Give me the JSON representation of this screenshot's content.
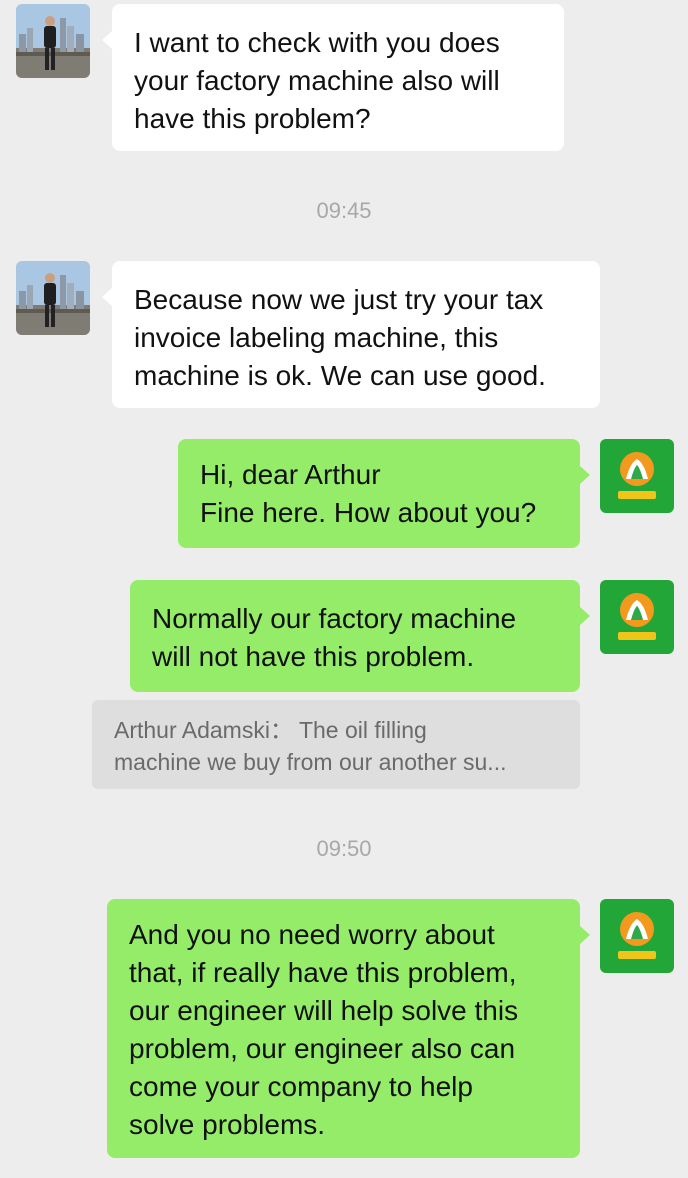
{
  "colors": {
    "background": "#ededed",
    "incoming_bubble": "#ffffff",
    "outgoing_bubble": "#95ec69",
    "timestamp_text": "#a8a8a8",
    "quote_background": "#dedede"
  },
  "contact": {
    "avatar_icon": "contact-photo-avatar"
  },
  "self": {
    "avatar_icon": "company-logo-avatar"
  },
  "messages": [
    {
      "side": "incoming",
      "text": "I want to check with you does\nyour factory machine also will\nhave this problem?"
    },
    {
      "type": "timestamp",
      "text": "09:45"
    },
    {
      "side": "incoming",
      "text": "Because now we just try your tax\ninvoice labeling machine, this\nmachine is ok. We can use good."
    },
    {
      "side": "outgoing",
      "text": "Hi, dear Arthur\nFine here. How about you?"
    },
    {
      "side": "outgoing",
      "text": "Normally our factory machine\nwill not have this problem."
    },
    {
      "type": "quote",
      "sender": "Arthur Adamski：",
      "line1": "The oil filling",
      "line2": "machine we buy from our another su..."
    },
    {
      "type": "timestamp",
      "text": "09:50"
    },
    {
      "side": "outgoing",
      "text": "And you no need worry about\nthat, if really have this problem,\nour engineer will help solve this\nproblem, our engineer also can\ncome your company to help\nsolve problems."
    }
  ]
}
